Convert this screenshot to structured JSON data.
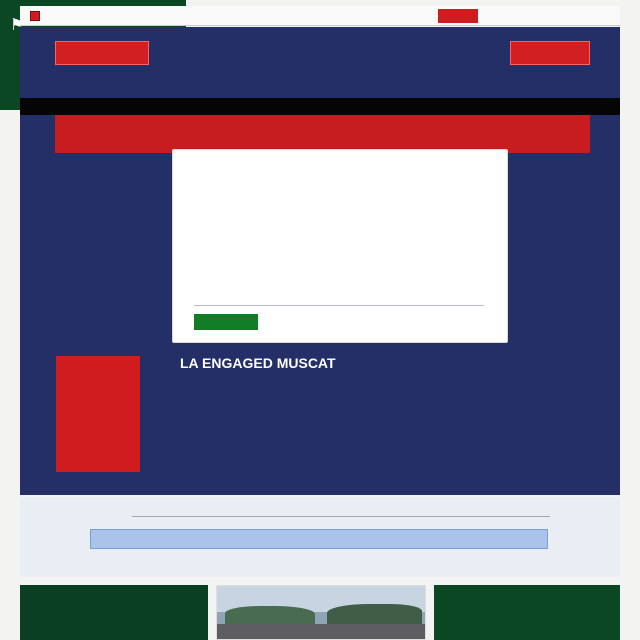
{
  "header": {
    "site_name": "",
    "nav_text": "",
    "top_button": ""
  },
  "hero": {
    "left_button": "",
    "right_button": "",
    "subtitle": "",
    "title": "",
    "title_accent": "",
    "notice": ""
  },
  "sidebar": {
    "links": [],
    "heading": "",
    "promo_text": "",
    "promo_price": ""
  },
  "card": {
    "title": "",
    "paragraphs": [],
    "cta": ""
  },
  "section": {
    "title": "LA ENGAGED MUSCAT",
    "paragraphs": []
  },
  "search": {
    "label": "",
    "placeholder": "",
    "note": ""
  },
  "features": {
    "left_title": "",
    "left_text": "",
    "right_title": "",
    "right_text": ""
  },
  "colors": {
    "navy": "#232f66",
    "red": "#d21f22",
    "green": "#117d26",
    "dark_green": "#0a4722",
    "search_blue": "#a9c3ea"
  },
  "icons": {
    "site_logo": "red-square-logo-icon",
    "feature_icon": "flag-icon"
  }
}
